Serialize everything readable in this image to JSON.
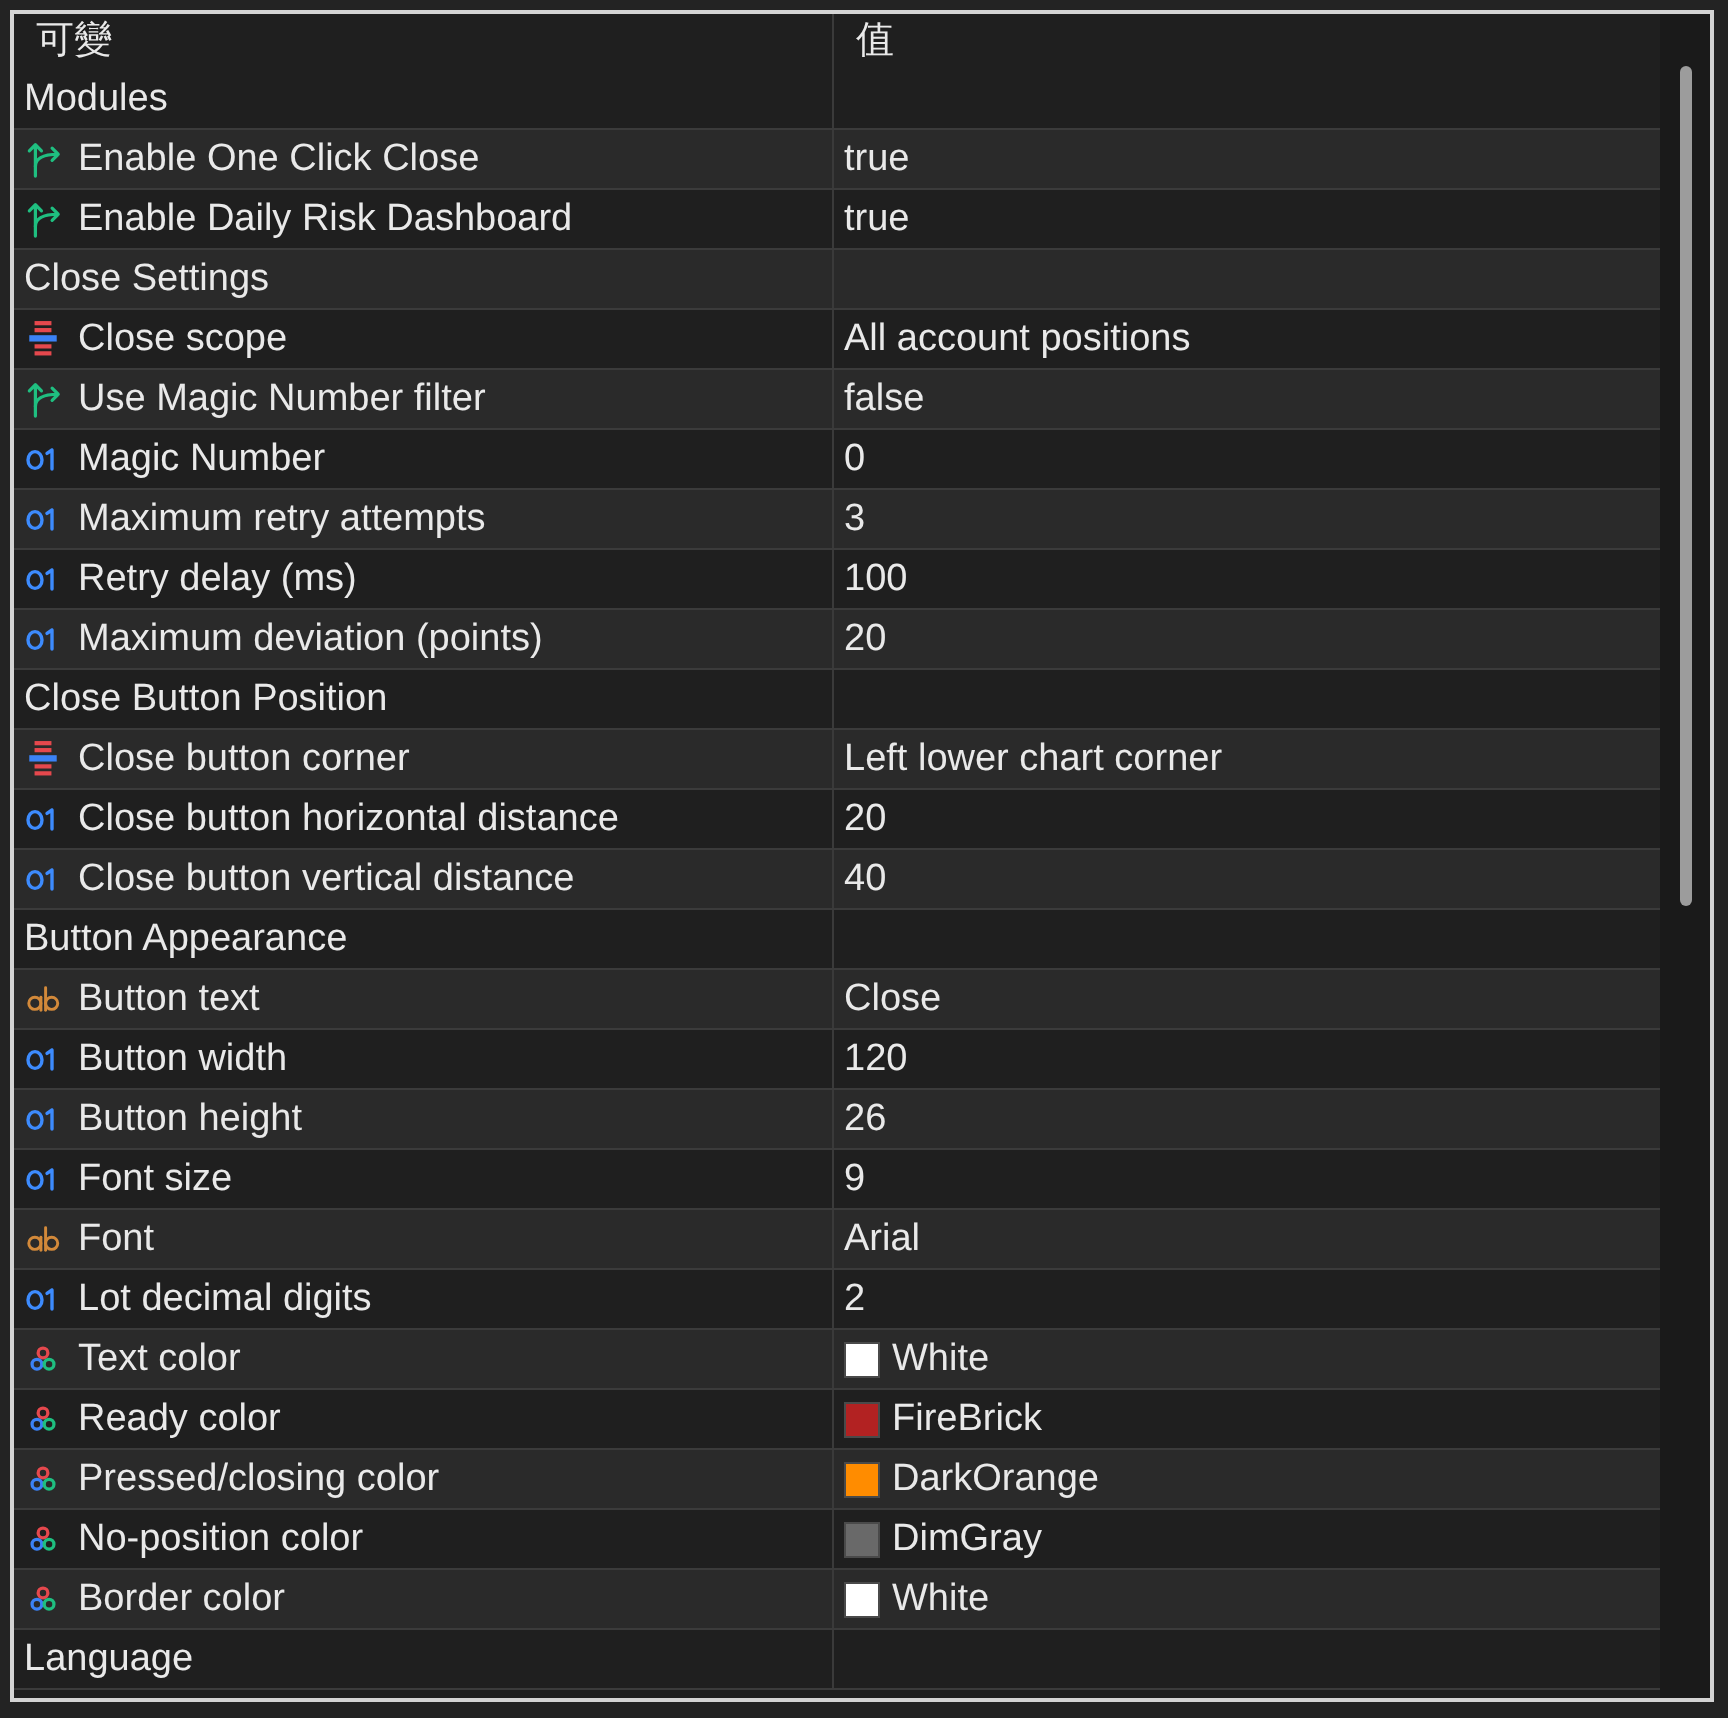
{
  "columns": [
    {
      "label": "可變"
    },
    {
      "label": "值"
    }
  ],
  "groups": [
    {
      "label": "Modules",
      "items": [
        {
          "kind": "bool",
          "name": "Enable One Click Close",
          "value": "true"
        },
        {
          "kind": "bool",
          "name": "Enable Daily Risk Dashboard",
          "value": "true"
        }
      ]
    },
    {
      "label": "Close Settings",
      "items": [
        {
          "kind": "enum",
          "name": "Close scope",
          "value": "All account positions"
        },
        {
          "kind": "bool",
          "name": "Use Magic Number filter",
          "value": "false"
        },
        {
          "kind": "int",
          "name": "Magic Number",
          "value": "0"
        },
        {
          "kind": "int",
          "name": "Maximum retry attempts",
          "value": "3"
        },
        {
          "kind": "int",
          "name": "Retry delay (ms)",
          "value": "100"
        },
        {
          "kind": "int",
          "name": "Maximum deviation (points)",
          "value": "20"
        }
      ]
    },
    {
      "label": "Close Button Position",
      "items": [
        {
          "kind": "enum",
          "name": "Close button corner",
          "value": "Left lower chart corner"
        },
        {
          "kind": "int",
          "name": "Close button horizontal distance",
          "value": "20"
        },
        {
          "kind": "int",
          "name": "Close button vertical distance",
          "value": "40"
        }
      ]
    },
    {
      "label": "Button Appearance",
      "items": [
        {
          "kind": "string",
          "name": "Button text",
          "value": "Close"
        },
        {
          "kind": "int",
          "name": "Button width",
          "value": "120"
        },
        {
          "kind": "int",
          "name": "Button height",
          "value": "26"
        },
        {
          "kind": "int",
          "name": "Font size",
          "value": "9"
        },
        {
          "kind": "string",
          "name": "Font",
          "value": "Arial"
        },
        {
          "kind": "int",
          "name": "Lot decimal digits",
          "value": "2"
        },
        {
          "kind": "color",
          "name": "Text color",
          "value": "White",
          "color": "#ffffff"
        },
        {
          "kind": "color",
          "name": "Ready color",
          "value": "FireBrick",
          "color": "#b22222"
        },
        {
          "kind": "color",
          "name": "Pressed/closing color",
          "value": "DarkOrange",
          "color": "#ff8c00"
        },
        {
          "kind": "color",
          "name": "No-position color",
          "value": "DimGray",
          "color": "#696969"
        },
        {
          "kind": "color",
          "name": "Border color",
          "value": "White",
          "color": "#ffffff"
        }
      ]
    },
    {
      "label": "Language"
    }
  ]
}
